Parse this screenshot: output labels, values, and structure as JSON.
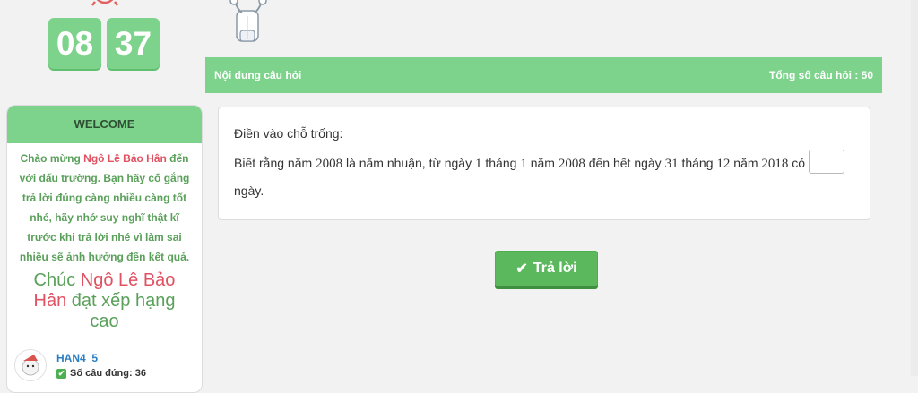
{
  "timer": {
    "minutes": "08",
    "seconds": "37"
  },
  "sidebar": {
    "header": "WELCOME",
    "greeting_prefix": "Chào mừng ",
    "student_name": "Ngô Lê Bảo Hân",
    "greeting_suffix": " đến với đấu trường. Bạn hãy cố gắng trả lời đúng càng nhiều càng tốt nhé, hãy nhớ suy nghĩ thật kĩ trước khi trả lời nhé vì làm sai nhiều sẽ ảnh hưởng đến kết quả.",
    "wish_prefix": "Chúc ",
    "wish_suffix": " đạt xếp hạng cao",
    "username": "HAN4_5",
    "correct_label": "Số câu đúng: 36"
  },
  "question_panel": {
    "header_left": "Nội dung câu hỏi",
    "header_right": "Tổng số câu hỏi : 50",
    "prompt": "Điền vào chỗ trống:",
    "text_part1": "Biết rằng năm ",
    "year1": "2008",
    "text_part2": " là năm nhuận, từ ngày ",
    "n1": "1",
    "text_part3": " tháng ",
    "n2": "1",
    "text_part4": " năm ",
    "year2": "2008",
    "text_part5": " đến hết ngày ",
    "n3": "31",
    "text_part6": " tháng ",
    "n4": "12",
    "text_part7": " năm ",
    "year3": "2018",
    "text_part8": " có",
    "unit": "ngày.",
    "answer_value": ""
  },
  "submit": {
    "label": "Trả lời"
  },
  "colors": {
    "accent_green": "#7dd38b",
    "button_green": "#5cb85c",
    "highlight_red": "#e05262"
  },
  "icons": [
    "alarm-clock-icon",
    "robot-mascot-icon",
    "check-icon",
    "avatar-icon"
  ]
}
